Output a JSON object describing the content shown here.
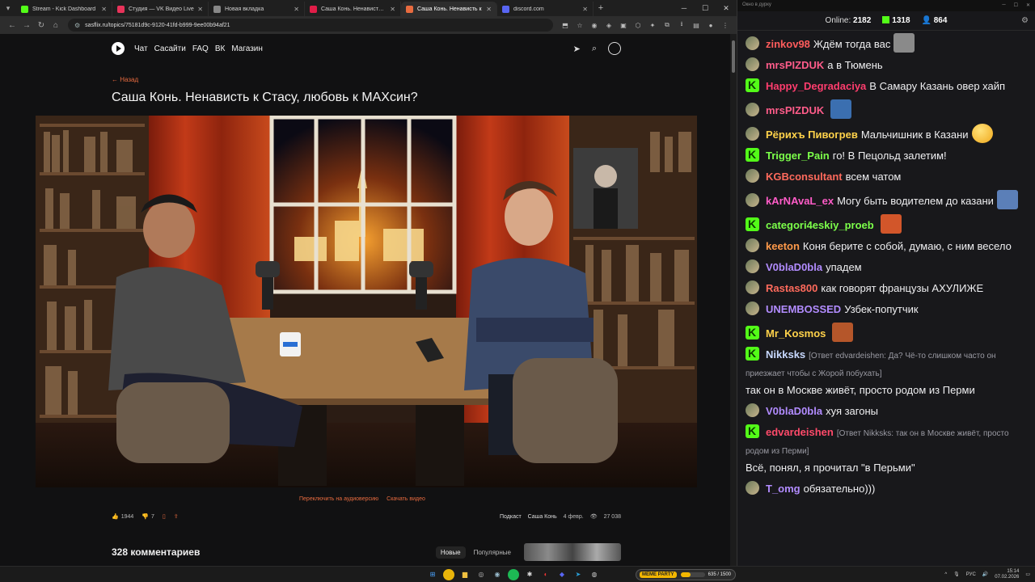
{
  "browser": {
    "tabs": [
      {
        "label": "Stream - Kick Dashboard",
        "color": "#53fc18",
        "active": false
      },
      {
        "label": "Студия — VK Видео Live",
        "color": "#e8335a",
        "active": false
      },
      {
        "label": "Новая вкладка",
        "color": "#888888",
        "active": false
      },
      {
        "label": "Саша Конь. Ненависть к Стас",
        "color": "#e11d48",
        "active": false
      },
      {
        "label": "Саша Конь. Ненависть к",
        "color": "#e86b3f",
        "active": true
      },
      {
        "label": "discord.com",
        "color": "#5865f2",
        "active": false
      }
    ],
    "url": "sasflix.ru/topics/75181d9c-9120-41fd-b999-9ee00b94af21"
  },
  "site": {
    "nav": [
      "Чат",
      "Сасайти",
      "FAQ",
      "ВК",
      "Магазин"
    ],
    "back_label": "← Назад",
    "title": "Саша Конь. Ненависть к Стасу, любовь к МАХсин?",
    "audio_link": "Переключить на аудиоверсию",
    "download_link": "Скачать видео",
    "likes": "1944",
    "dislikes": "7",
    "tag1": "Подкаст",
    "tag2": "Саша Конь",
    "date": "4 февр.",
    "views": "27 038",
    "comments_title": "328 комментариев",
    "sort_new": "Новые",
    "sort_popular": "Популярные"
  },
  "chat": {
    "window_title": "Окно в дурку",
    "online_label": "Online:",
    "online": "2182",
    "kick_count": "1318",
    "other_count": "864",
    "messages": [
      {
        "badge": "ava",
        "nick": "zinkov98",
        "color": "#ff5c5c",
        "text": "Ждём тогда вас",
        "reply": "",
        "emote": "#8a8a8a"
      },
      {
        "badge": "ava",
        "nick": "mrsPIZDUK",
        "color": "#ff5c8a",
        "text": "а в Тюмень",
        "reply": "",
        "emote": ""
      },
      {
        "badge": "kick",
        "nick": "Happy_Degradaciya",
        "color": "#ff3d6e",
        "text": "В Самару Казань овер хайп",
        "reply": "",
        "emote": ""
      },
      {
        "badge": "ava",
        "nick": "mrsPIZDUK",
        "color": "#ff5c8a",
        "text": "",
        "reply": "",
        "emote": "#3b6fb0"
      },
      {
        "badge": "ava",
        "nick": "Рёрихъ Пивогрев",
        "color": "#ffd24a",
        "text": "Мальчишник в Казани",
        "reply": "",
        "emote": "smile"
      },
      {
        "badge": "kick",
        "nick": "Trigger_Pain",
        "color": "#7cff4a",
        "text": "го! В Пецольд залетим!",
        "reply": "",
        "emote": ""
      },
      {
        "badge": "ava",
        "nick": "KGBconsultant",
        "color": "#ff6a5c",
        "text": "всем чатом",
        "reply": "",
        "emote": ""
      },
      {
        "badge": "ava",
        "nick": "kArNAvaL_ex",
        "color": "#ff5cc8",
        "text": "Могу быть водителем до казани",
        "reply": "",
        "emote": "#5b7fb8"
      },
      {
        "badge": "kick",
        "nick": "categori4eskiy_proeb",
        "color": "#7cff4a",
        "text": "",
        "reply": "",
        "emote": "#d2562a"
      },
      {
        "badge": "ava",
        "nick": "keeton",
        "color": "#ff9a4a",
        "text": "Коня берите с собой, думаю, с ним весело",
        "reply": "",
        "emote": ""
      },
      {
        "badge": "ava",
        "nick": "V0blaD0bla",
        "color": "#b28cff",
        "text": "упадем",
        "reply": "",
        "emote": ""
      },
      {
        "badge": "ava",
        "nick": "Rastas800",
        "color": "#ff6a5c",
        "text": "как говорят французы АХУЛИЖЕ",
        "reply": "",
        "emote": ""
      },
      {
        "badge": "ava",
        "nick": "UNEMBOSSED",
        "color": "#b28cff",
        "text": "Узбек-попутчик",
        "reply": "",
        "emote": ""
      },
      {
        "badge": "kick",
        "nick": "Mr_Kosmos",
        "color": "#ffd24a",
        "text": "",
        "reply": "",
        "emote": "#b5562a"
      },
      {
        "badge": "kick",
        "nick": "Nikksks",
        "color": "#c8d9ff",
        "text": "так он в Москве живёт, просто родом из Перми",
        "reply": "[Ответ edvardeishen: Да? Чё-то слишком часто он приезжает чтобы с Жорой побухать]",
        "emote": ""
      },
      {
        "badge": "ava",
        "nick": "V0blaD0bla",
        "color": "#b28cff",
        "text": "хуя загоны",
        "reply": "",
        "emote": ""
      },
      {
        "badge": "kick",
        "nick": "edvardeishen",
        "color": "#ff4a6a",
        "text": "Всё, понял, я прочитал \"в Перьми\"",
        "reply": "[Ответ Nikksks: так он в Москве живёт, просто родом из Перми]",
        "emote": ""
      },
      {
        "badge": "ava",
        "nick": "T_omg",
        "color": "#b28cff",
        "text": "обязательно)))",
        "reply": "",
        "emote": ""
      }
    ]
  },
  "taskbar": {
    "meme_label": "MEME PARTY",
    "meme_count": "635 / 1500",
    "meme_progress": 0.42,
    "lang": "РУС",
    "time": "15:14",
    "date": "07.02.2026"
  },
  "colors": {
    "accent": "#e86b3f",
    "kick": "#53fc18"
  }
}
